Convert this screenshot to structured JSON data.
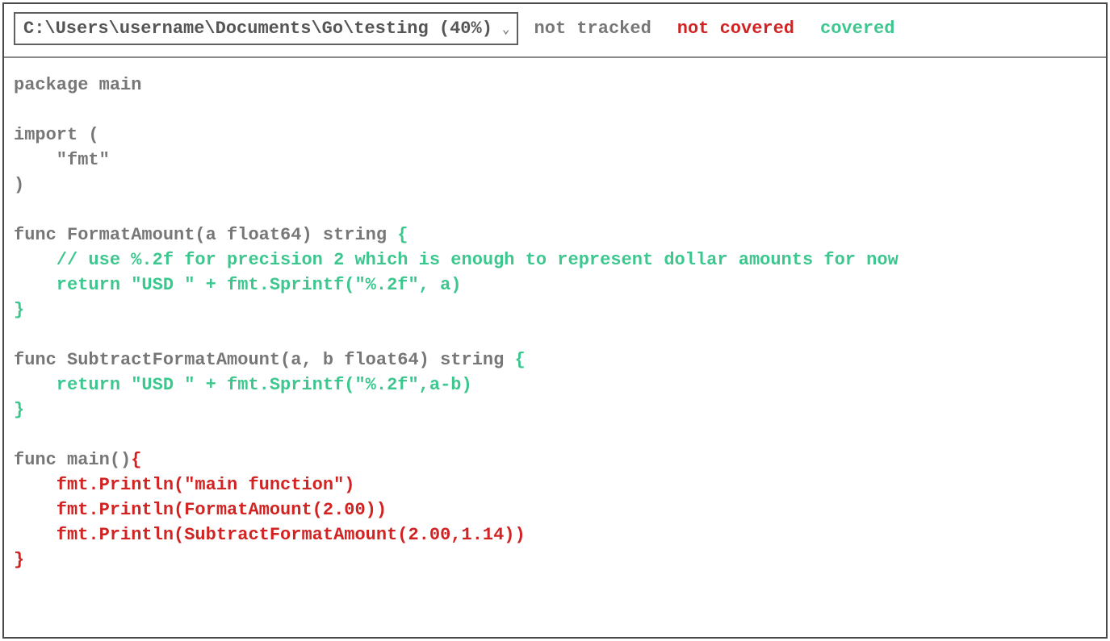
{
  "toolbar": {
    "file_path": "C:\\Users\\username\\Documents\\Go\\testing (40%)",
    "legend": {
      "not_tracked": "not tracked",
      "not_covered": "not covered",
      "covered": "covered"
    }
  },
  "colors": {
    "not_tracked": "#777777",
    "not_covered": "#d22222",
    "covered": "#3cc78e"
  },
  "code": {
    "l1": "package main",
    "l2": "",
    "l3": "import (",
    "l4": "    \"fmt\"",
    "l5": ")",
    "l6": "",
    "l7": "func FormatAmount(a float64) string ",
    "l7b": "{",
    "l8": "    // use %.2f for precision 2 which is enough to represent dollar amounts for now",
    "l9": "    return \"USD \" + fmt.Sprintf(\"%.2f\", a)",
    "l10": "}",
    "l11": "",
    "l12": "func SubtractFormatAmount(a, b float64) string ",
    "l12b": "{",
    "l13": "    return \"USD \" + fmt.Sprintf(\"%.2f\",a-b)",
    "l14": "}",
    "l15": "",
    "l16": "func main()",
    "l16b": "{",
    "l17": "    fmt.Println(\"main function\")",
    "l18": "    fmt.Println(FormatAmount(2.00))",
    "l19": "    fmt.Println(SubtractFormatAmount(2.00,1.14))",
    "l20": "}"
  }
}
